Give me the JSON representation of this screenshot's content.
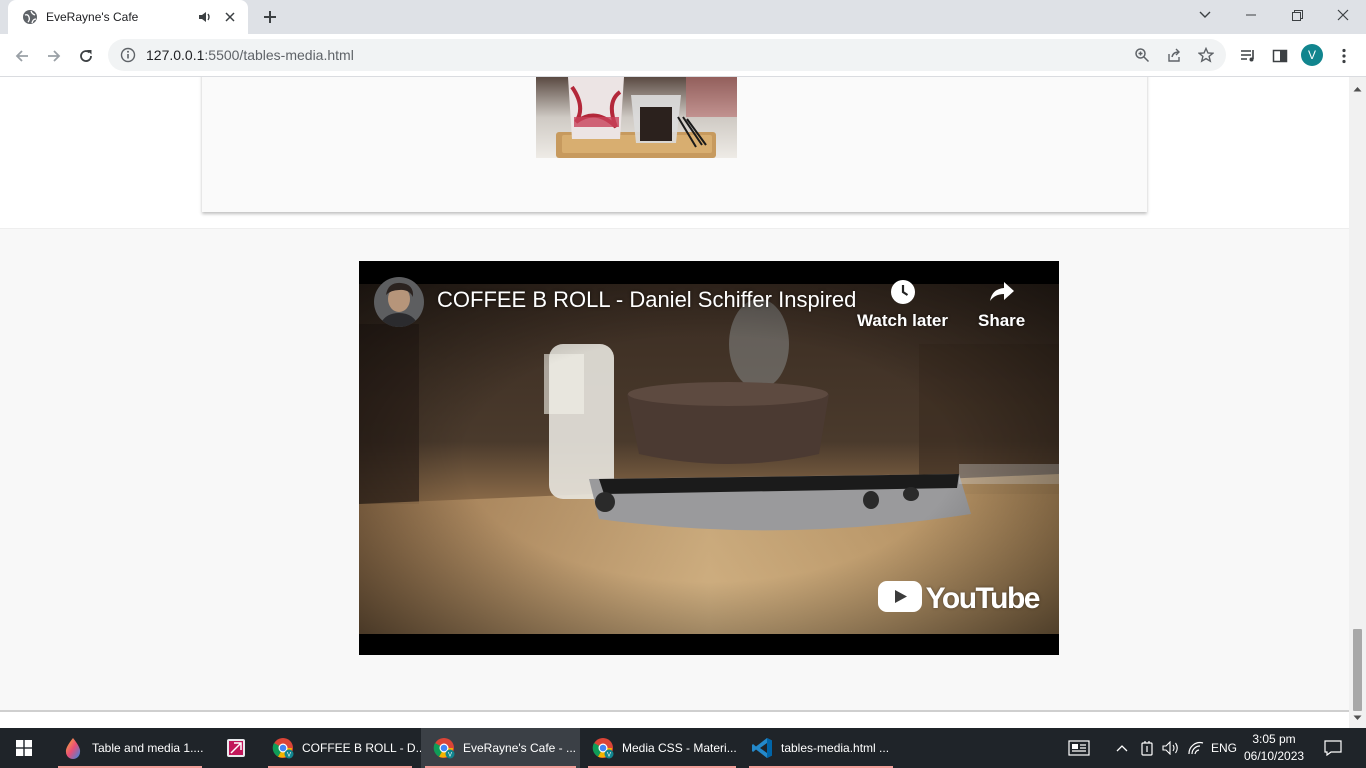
{
  "browser": {
    "tab_title": "EveRayne's Cafe",
    "url_host": "127.0.0.1",
    "url_path": ":5500/tables-media.html",
    "profile_initial": "V"
  },
  "video": {
    "title": "COFFEE B ROLL - Daniel Schiffer Inspired",
    "watch_later_label": "Watch later",
    "share_label": "Share",
    "logo_text": "YouTube"
  },
  "taskbar": {
    "items": [
      {
        "label": "Table and media 1....",
        "icon": "paint-drop-icon"
      },
      {
        "label": "",
        "icon": "snip-tool-icon"
      },
      {
        "label": "COFFEE B ROLL - D...",
        "icon": "chrome-icon"
      },
      {
        "label": "EveRayne's Cafe - ...",
        "icon": "chrome-icon"
      },
      {
        "label": "Media CSS - Materi...",
        "icon": "chrome-icon"
      },
      {
        "label": "tables-media.html ...",
        "icon": "vscode-icon"
      }
    ],
    "language": "ENG",
    "time": "3:05 pm",
    "date": "06/10/2023"
  }
}
